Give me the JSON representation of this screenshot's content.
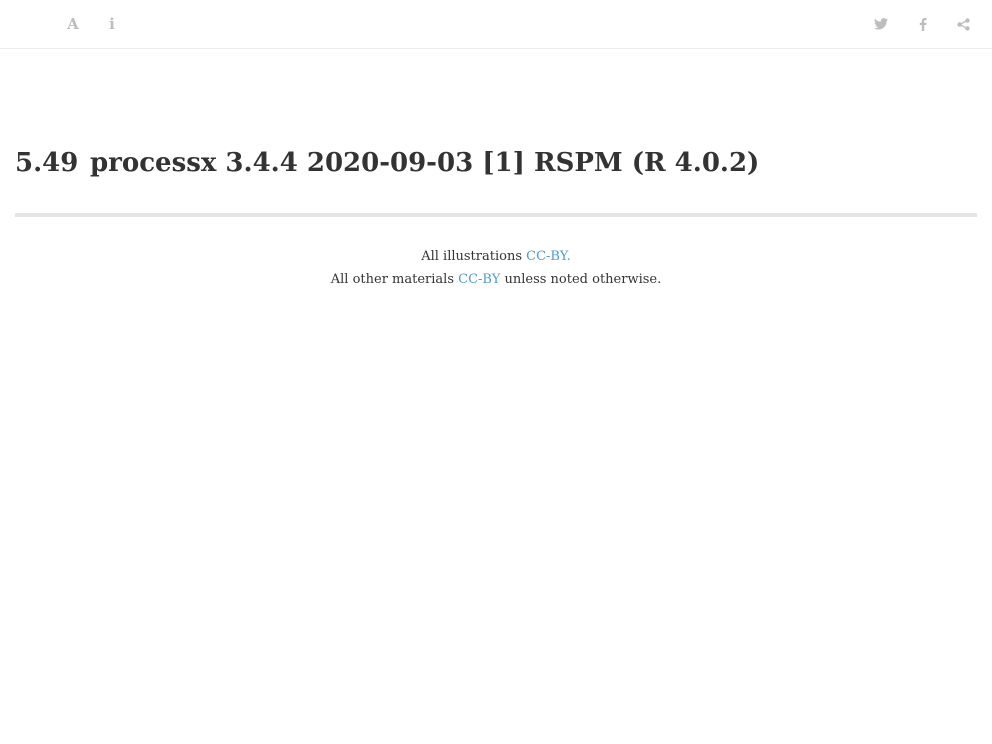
{
  "toolbar": {
    "left_icons": [
      "font-icon",
      "info-icon"
    ],
    "right_icons": [
      "twitter-icon",
      "facebook-icon",
      "share-icon"
    ],
    "font_glyph": "A",
    "info_glyph": "i"
  },
  "main": {
    "section_number": "5.49",
    "section_title": "processx 3.4.4 2020-09-03 [1] RSPM (R 4.0.2)"
  },
  "footer": {
    "line1_text": "All illustrations ",
    "line1_link": "CC-BY.",
    "line2_text": "All other materials ",
    "line2_link": "CC-BY",
    "line2_suffix": " unless noted otherwise."
  },
  "colors": {
    "icon": "#bdbdbd",
    "link": "#4f9ad6",
    "text": "#333333",
    "rule": "#e5e5e5"
  }
}
